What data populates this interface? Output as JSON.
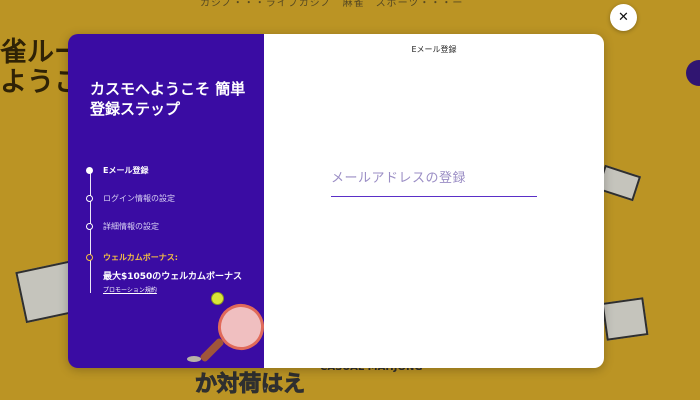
{
  "background": {
    "top_nav_text": "カジノ・・・ライブカジノ　麻雀　スポーツ・・・ー",
    "heading_line1": "雀ルー",
    "heading_line2": "ようこ",
    "bottom_text": "か対荷はえ",
    "bottom_sub": "CASUAL MAHJONG"
  },
  "modal": {
    "welcome_title": "カスモへようこそ 簡単登録ステップ",
    "steps": [
      {
        "label": "Eメール登録",
        "active": true
      },
      {
        "label": "ログイン情報の設定",
        "active": false
      },
      {
        "label": "詳細情報の設定",
        "active": false
      }
    ],
    "promo": {
      "title": "ウェルカムボーナス:",
      "description": "最大$1050のウェルカムボーナス",
      "link": "プロモーション規約"
    },
    "form": {
      "header": "Eメール登録",
      "email_label": "メールアドレスの登録",
      "email_value": ""
    },
    "close_icon": "✕"
  },
  "colors": {
    "sidebar": "#3a0ca3",
    "accent": "#5a2fc7",
    "promo": "#f5c142"
  }
}
